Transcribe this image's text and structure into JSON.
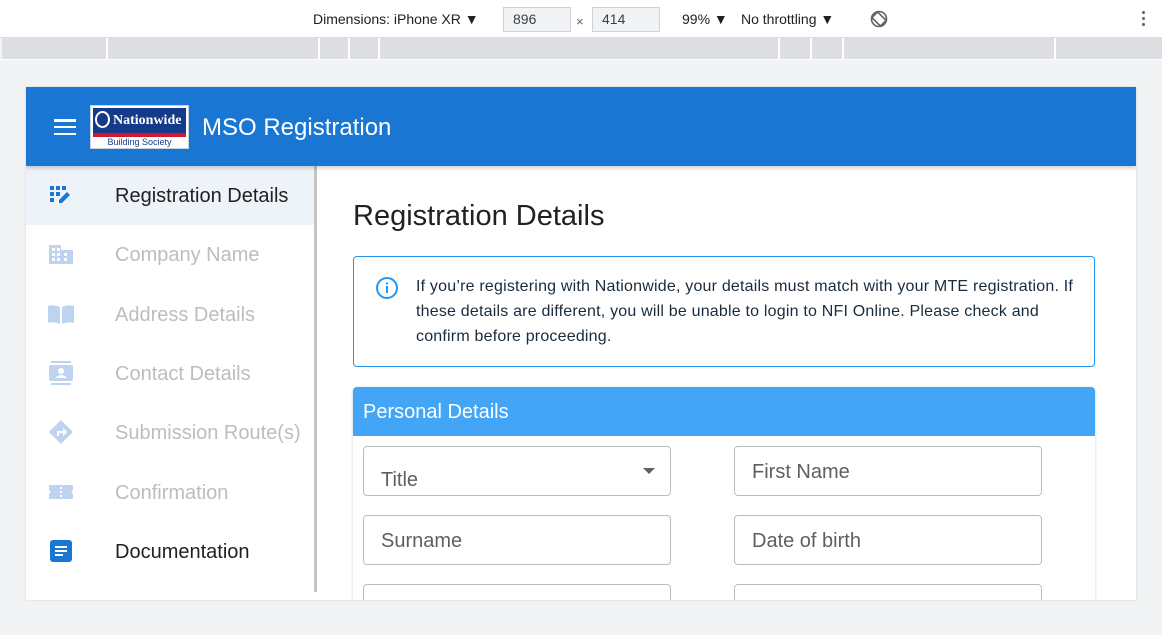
{
  "devtools": {
    "dimensions_label": "Dimensions: iPhone XR ▼",
    "width": "896",
    "times": "×",
    "height": "414",
    "zoom": "99% ▼",
    "throttling": "No throttling ▼",
    "rotate_icon": "rotate-icon",
    "more_icon": "more-vertical-icon"
  },
  "app": {
    "title": "MSO Registration",
    "menu_icon": "hamburger-menu-icon",
    "logo": {
      "top_text": "Nationwide",
      "bottom_text": "Building Society"
    },
    "brand_color": "#1976d2"
  },
  "sidebar": {
    "items": [
      {
        "label": "Registration Details",
        "icon": "registration-edit-icon",
        "state": "active"
      },
      {
        "label": "Company Name",
        "icon": "building-icon",
        "state": "disabled"
      },
      {
        "label": "Address Details",
        "icon": "book-open-icon",
        "state": "disabled"
      },
      {
        "label": "Contact Details",
        "icon": "contact-card-icon",
        "state": "disabled"
      },
      {
        "label": "Submission Route(s)",
        "icon": "route-diamond-icon",
        "state": "disabled"
      },
      {
        "label": "Confirmation",
        "icon": "ticket-icon",
        "state": "disabled"
      },
      {
        "label": "Documentation",
        "icon": "document-icon",
        "state": "enabled"
      }
    ]
  },
  "main": {
    "title": "Registration Details",
    "info_text": "If you’re registering with Nationwide, your details must match with your MTE registration. If these details are different, you will be unable to login to NFI Online. Please check and confirm before proceeding.",
    "info_icon": "info-circle-icon",
    "card": {
      "header": "Personal Details",
      "header_color": "#42a5f5",
      "fields": {
        "title": "Title",
        "first_name": "First Name",
        "surname": "Surname",
        "dob": "Date of birth"
      }
    }
  }
}
